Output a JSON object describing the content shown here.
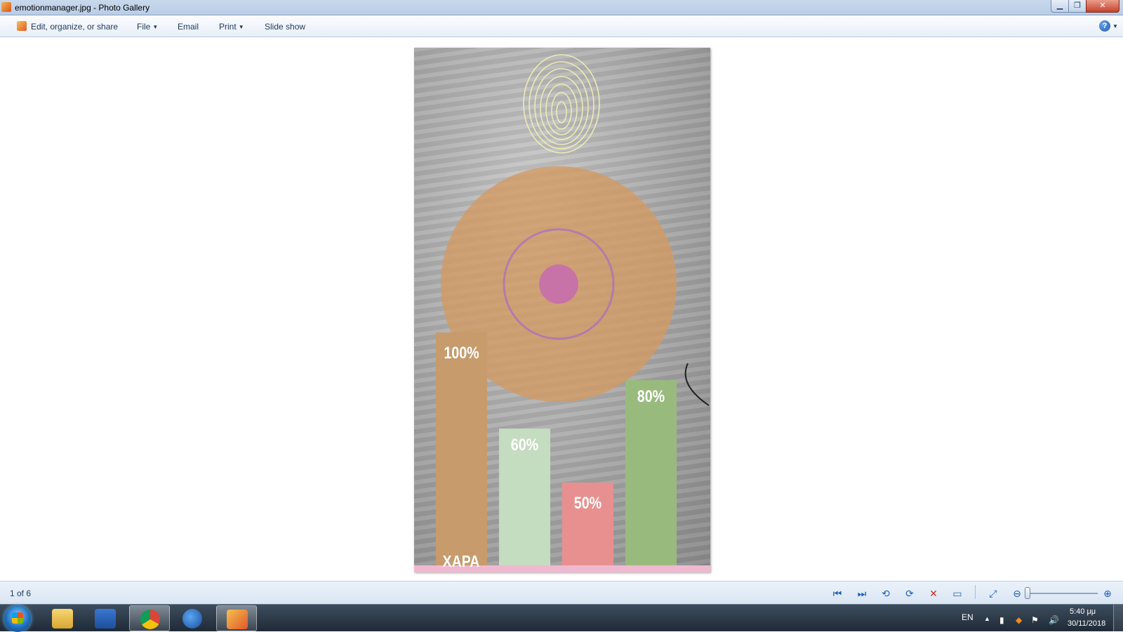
{
  "window": {
    "title": "emotionmanager.jpg - Photo Gallery",
    "controls": {
      "minimize": "▁",
      "maximize": "❐",
      "close": "✕"
    }
  },
  "commandbar": {
    "edit": "Edit, organize, or share",
    "file": "File",
    "email": "Email",
    "print": "Print",
    "slideshow": "Slide show",
    "help": "?"
  },
  "photo": {
    "emotion_label": "ΧΑΡΑ",
    "colors": {
      "bar1": "#c89b6c",
      "bar2": "#c4dcbf",
      "bar3": "#e8908f",
      "bar4": "#98bb7d",
      "circle": "#d49a61",
      "center": "#c56bb0",
      "fingerprint": "#f4f1b5"
    }
  },
  "chart_data": {
    "type": "bar",
    "categories": [
      "",
      "",
      "",
      ""
    ],
    "values": [
      100,
      60,
      50,
      80
    ],
    "value_labels": [
      "100%",
      "60%",
      "50%",
      "80%"
    ],
    "ylim": [
      0,
      100
    ]
  },
  "statusbar": {
    "counter": "1 of 6",
    "icons": [
      "previous-icon",
      "next-icon",
      "rotate-left-icon",
      "rotate-right-icon",
      "delete-icon",
      "slideshow-icon",
      "actual-size-icon",
      "zoom-out-icon",
      "zoom-in-icon"
    ]
  },
  "taskbar": {
    "apps": [
      "windows-explorer",
      "microsoft-word",
      "google-chrome",
      "firefox",
      "photo-gallery"
    ],
    "active_app": "photo-gallery",
    "language": "EN",
    "time": "5:40 μμ",
    "date": "30/11/2018"
  }
}
